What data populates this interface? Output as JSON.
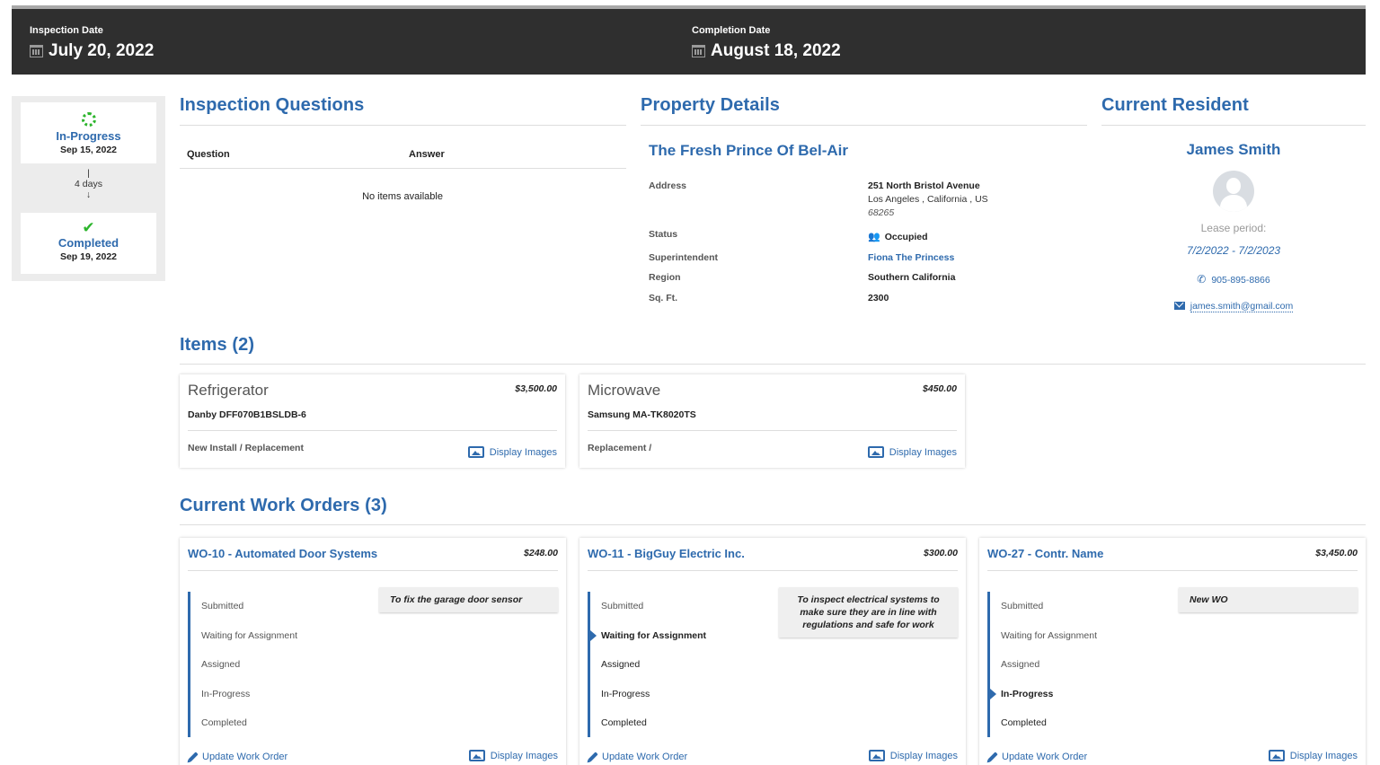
{
  "header": {
    "inspection_date_label": "Inspection Date",
    "inspection_date": "July 20, 2022",
    "completion_date_label": "Completion Date",
    "completion_date": "August 18, 2022"
  },
  "status": {
    "start_label": "In-Progress",
    "start_date": "Sep 15, 2022",
    "duration": "4 days",
    "end_label": "Completed",
    "end_date": "Sep 19, 2022"
  },
  "questions": {
    "title": "Inspection Questions",
    "col_question": "Question",
    "col_answer": "Answer",
    "empty": "No items available"
  },
  "property": {
    "title": "Property Details",
    "name": "The Fresh Prince Of Bel-Air",
    "address_label": "Address",
    "address_line1": "251 North Bristol Avenue",
    "address_line2": "Los Angeles , California , US",
    "zip": "68265",
    "status_label": "Status",
    "status_value": "Occupied",
    "superintendent_label": "Superintendent",
    "superintendent_value": "Fiona The Princess",
    "region_label": "Region",
    "region_value": "Southern California",
    "sqft_label": "Sq. Ft.",
    "sqft_value": "2300"
  },
  "resident": {
    "title": "Current Resident",
    "name": "James Smith",
    "lease_label": "Lease period:",
    "lease_value": "7/2/2022 - 7/2/2023",
    "phone": "905-895-8866",
    "email": "james.smith@gmail.com"
  },
  "items": {
    "title": "Items (2)",
    "display_images": "Display Images",
    "list": [
      {
        "name": "Refrigerator",
        "price": "$3,500.00",
        "model": "Danby DFF070B1BSLDB-6",
        "kind": "New Install / Replacement"
      },
      {
        "name": "Microwave",
        "price": "$450.00",
        "model": "Samsung MA-TK8020TS",
        "kind": "Replacement /"
      }
    ]
  },
  "work_orders": {
    "title": "Current Work Orders (3)",
    "update_label": "Update Work Order",
    "display_images": "Display Images",
    "steps": [
      "Submitted",
      "Waiting for Assignment",
      "Assigned",
      "In-Progress",
      "Completed"
    ],
    "list": [
      {
        "title": "WO-10 - Automated Door Systems",
        "price": "$248.00",
        "note": "To fix the garage door sensor",
        "active_step": null
      },
      {
        "title": "WO-11 - BigGuy Electric Inc.",
        "price": "$300.00",
        "note": "To inspect electrical systems to make sure they are in line with regulations and safe for work",
        "active_step": "Waiting for Assignment"
      },
      {
        "title": "WO-27 - Contr. Name",
        "price": "$3,450.00",
        "note": "New WO",
        "active_step": "In-Progress"
      }
    ]
  },
  "colors": {
    "accent": "#2e6aad",
    "header_bg": "#2f2f2f",
    "success": "#2db52d"
  }
}
